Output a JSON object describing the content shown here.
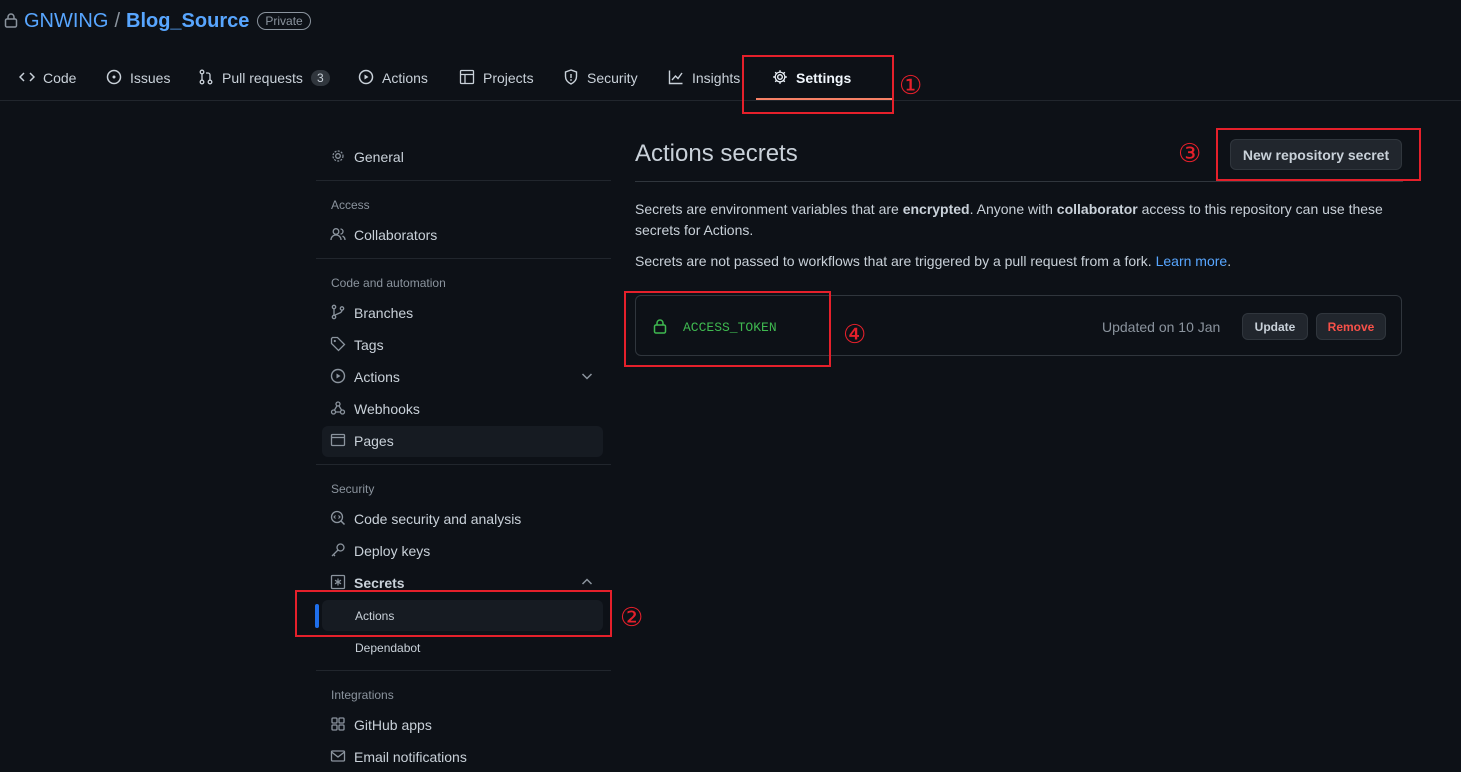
{
  "repo": {
    "owner": "GNWING",
    "separator": "/",
    "name": "Blog_Source",
    "visibility": "Private"
  },
  "nav": {
    "tabs": [
      {
        "label": "Code",
        "icon": "code-icon"
      },
      {
        "label": "Issues",
        "icon": "issue-icon"
      },
      {
        "label": "Pull requests",
        "icon": "pull-request-icon",
        "count": "3"
      },
      {
        "label": "Actions",
        "icon": "play-icon"
      },
      {
        "label": "Projects",
        "icon": "table-icon"
      },
      {
        "label": "Security",
        "icon": "shield-icon"
      },
      {
        "label": "Insights",
        "icon": "graph-icon"
      },
      {
        "label": "Settings",
        "icon": "gear-icon",
        "selected": true
      }
    ]
  },
  "annotations": {
    "m1": "①",
    "m2": "②",
    "m3": "③",
    "m4": "④"
  },
  "sidebar": {
    "general": "General",
    "access_heading": "Access",
    "collaborators": "Collaborators",
    "code_heading": "Code and automation",
    "branches": "Branches",
    "tags": "Tags",
    "actions": "Actions",
    "webhooks": "Webhooks",
    "pages": "Pages",
    "security_heading": "Security",
    "code_security": "Code security and analysis",
    "deploy_keys": "Deploy keys",
    "secrets": "Secrets",
    "secrets_actions": "Actions",
    "secrets_dependabot": "Dependabot",
    "integrations_heading": "Integrations",
    "github_apps": "GitHub apps",
    "email_notifications": "Email notifications"
  },
  "main": {
    "title": "Actions secrets",
    "new_button": "New repository secret",
    "para1_a": "Secrets are environment variables that are ",
    "para1_b": "encrypted",
    "para1_c": ". Anyone with ",
    "para1_d": "collaborator",
    "para1_e": " access to this repository can use these secrets for Actions.",
    "para2_a": "Secrets are not passed to workflows that are triggered by a pull request from a fork. ",
    "learn_more": "Learn more",
    "para2_b": ".",
    "secret": {
      "name": "ACCESS_TOKEN",
      "updated": "Updated on 10 Jan",
      "update_button": "Update",
      "remove_button": "Remove"
    }
  },
  "colors": {
    "accent": "#58a6ff",
    "danger": "#f85149",
    "success": "#3fb950",
    "annotation": "#e5202b"
  }
}
